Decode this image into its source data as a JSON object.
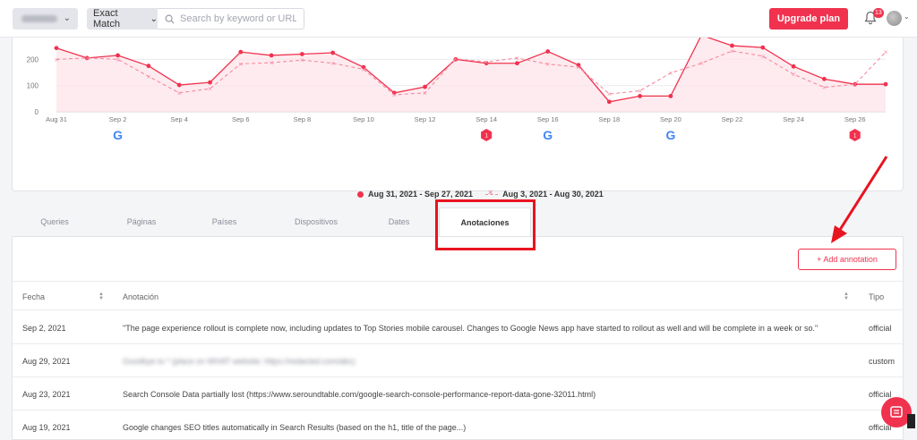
{
  "topbar": {
    "match_label": "Exact Match",
    "search_placeholder": "Search by keyword or URL",
    "upgrade_label": "Upgrade plan",
    "notif_count": "13"
  },
  "chart_data": {
    "type": "line",
    "ylim": [
      0,
      300
    ],
    "yticks": [
      "0",
      "100",
      "200"
    ],
    "x": [
      "Aug 31",
      "Sep 1",
      "Sep 2",
      "Sep 3",
      "Sep 4",
      "Sep 5",
      "Sep 6",
      "Sep 7",
      "Sep 8",
      "Sep 9",
      "Sep 10",
      "Sep 11",
      "Sep 12",
      "Sep 13",
      "Sep 14",
      "Sep 15",
      "Sep 16",
      "Sep 17",
      "Sep 18",
      "Sep 19",
      "Sep 20",
      "Sep 21",
      "Sep 22",
      "Sep 23",
      "Sep 24",
      "Sep 25",
      "Sep 26",
      "Sep 27"
    ],
    "xtick_labels": [
      "Aug 31",
      "Sep 2",
      "Sep 4",
      "Sep 6",
      "Sep 8",
      "Sep 10",
      "Sep 12",
      "Sep 14",
      "Sep 16",
      "Sep 18",
      "Sep 20",
      "Sep 22",
      "Sep 24",
      "Sep 26"
    ],
    "series": [
      {
        "name": "Aug 31, 2021 - Sep 27, 2021",
        "color": "#f0324e",
        "style": "solid",
        "values": [
          243,
          205,
          215,
          175,
          102,
          112,
          228,
          215,
          220,
          225,
          170,
          72,
          95,
          200,
          185,
          185,
          230,
          178,
          38,
          60,
          60,
          292,
          252,
          245,
          173,
          125,
          105,
          105
        ]
      },
      {
        "name": "Aug 3, 2021 - Aug 30, 2021",
        "color": "#f58aa0",
        "style": "dashed",
        "values": [
          200,
          205,
          200,
          135,
          72,
          88,
          183,
          187,
          197,
          185,
          162,
          65,
          72,
          202,
          190,
          205,
          182,
          170,
          68,
          80,
          148,
          185,
          232,
          212,
          143,
          93,
          105,
          228
        ]
      }
    ],
    "markers": [
      {
        "x": "Sep 2",
        "kind": "google"
      },
      {
        "x": "Sep 14",
        "kind": "badge",
        "label": "1"
      },
      {
        "x": "Sep 16",
        "kind": "google"
      },
      {
        "x": "Sep 20",
        "kind": "google"
      },
      {
        "x": "Sep 26",
        "kind": "badge",
        "label": "1"
      }
    ]
  },
  "tabs": [
    {
      "label": "Queries",
      "active": false
    },
    {
      "label": "Páginas",
      "active": false
    },
    {
      "label": "Países",
      "active": false
    },
    {
      "label": "Dispositivos",
      "active": false
    },
    {
      "label": "Dates",
      "active": false
    },
    {
      "label": "Anotaciones",
      "active": true
    }
  ],
  "annotations": {
    "add_label": "+ Add annotation",
    "columns": {
      "date": "Fecha",
      "note": "Anotación",
      "type": "Tipo"
    },
    "rows": [
      {
        "date": "Sep 2, 2021",
        "note": "\"The page experience rollout is complete now, including updates to Top Stories mobile carousel. Changes to Google News app have started to rollout as well and will be complete in a week or so.\"",
        "type": "official"
      },
      {
        "date": "Aug 29, 2021",
        "note": "Goodbye to * (place on WHAT website: https://redacted.com/abc)",
        "type": "custom"
      },
      {
        "date": "Aug 23, 2021",
        "note": "Search Console Data partially lost (https://www.seroundtable.com/google-search-console-performance-report-data-gone-32011.html)",
        "type": "official"
      },
      {
        "date": "Aug 19, 2021",
        "note": "Google changes SEO titles automatically in Search Results (based on the h1, title of the page...)",
        "type": "official"
      }
    ]
  }
}
